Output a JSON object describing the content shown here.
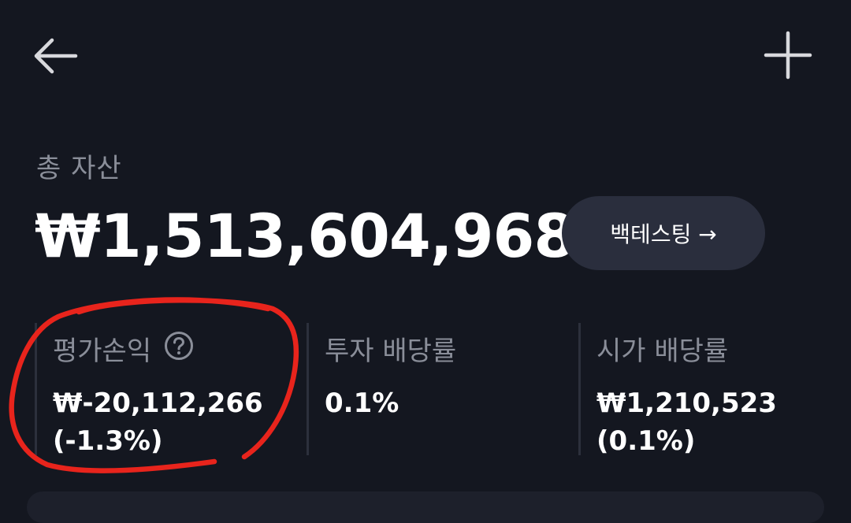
{
  "header": {
    "back_icon": "arrow-left-icon",
    "add_icon": "plus-icon"
  },
  "summary": {
    "total_label": "총 자산",
    "total_value": "₩1,513,604,968",
    "backtest_label": "백테스팅 →"
  },
  "stats": [
    {
      "label": "평가손익",
      "value_line1": "₩-20,112,266",
      "value_line2": "(-1.3%)",
      "help_icon": "question-circle-icon"
    },
    {
      "label": "투자 배당률",
      "value_line1": "0.1%",
      "value_line2": ""
    },
    {
      "label": "시가 배당률",
      "value_line1": "₩1,210,523",
      "value_line2": "(0.1%)"
    }
  ],
  "colors": {
    "background": "#141720",
    "muted_text": "#8a8e99",
    "button_bg": "#2a2e3d",
    "annotation": "#e8241c"
  }
}
